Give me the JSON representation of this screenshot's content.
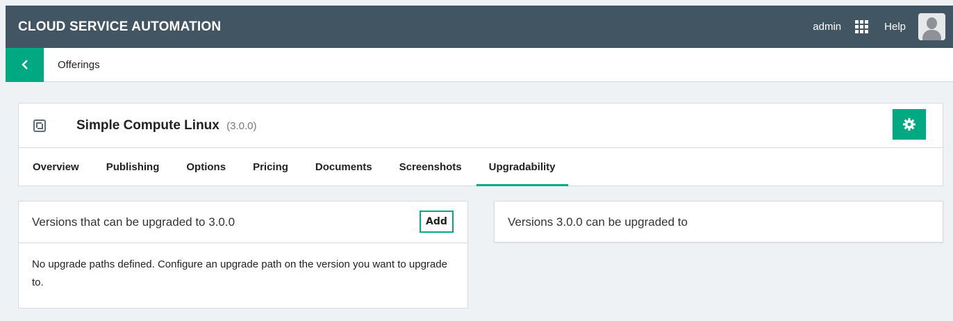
{
  "header": {
    "app_title": "CLOUD SERVICE AUTOMATION",
    "user": "admin",
    "apps_icon": "grid-icon",
    "help": "Help",
    "avatar_icon": "user-avatar-icon"
  },
  "breadcrumb": {
    "back_icon": "chevron-left-icon",
    "label": "Offerings"
  },
  "offering": {
    "icon": "service-offering-icon",
    "name": "Simple Compute Linux",
    "version": "(3.0.0)",
    "settings_icon": "gear-icon",
    "tabs": [
      {
        "label": "Overview"
      },
      {
        "label": "Publishing"
      },
      {
        "label": "Options"
      },
      {
        "label": "Pricing"
      },
      {
        "label": "Documents"
      },
      {
        "label": "Screenshots"
      },
      {
        "label": "Upgradability",
        "active": true
      }
    ]
  },
  "upgrade_from": {
    "title": "Versions that can be upgraded to 3.0.0",
    "add_label": "Add",
    "empty_message": "No upgrade paths defined. Configure an upgrade path on the version you want to upgrade to."
  },
  "upgrade_to": {
    "title": "Versions 3.0.0 can be upgraded to"
  },
  "colors": {
    "header_bg": "#425563",
    "accent": "#01a982",
    "page_bg": "#eff2f5"
  }
}
